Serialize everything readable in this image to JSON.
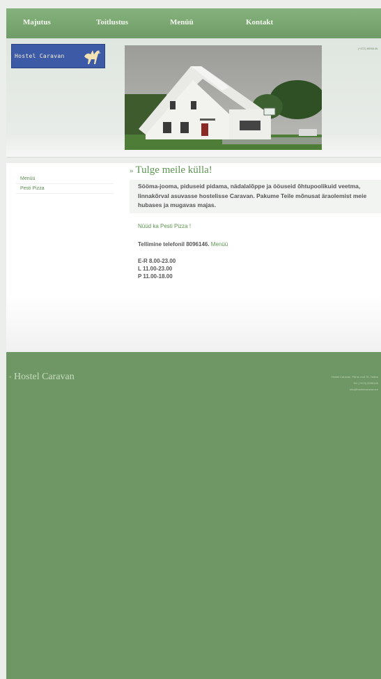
{
  "nav": {
    "items": [
      "Majutus",
      "Toitlustus",
      "Menüü",
      "Kontakt"
    ]
  },
  "header": {
    "logo_text": "Hostel Caravan",
    "phone_text": "(+372) 8096146"
  },
  "sidebar": {
    "items": [
      "Menüü",
      "Pesti Pizza"
    ]
  },
  "main": {
    "title": "Tulge meile külla!",
    "intro": "Sööma-jooma, piduseid pidama, nädalalõppe ja ööuseid õhtupoolikuid veetma, linnakõrval asuvasse hostelisse Caravan. Pakume Teile mõnusat äraolemist meie hubases ja mugavas majas.",
    "pizza_link": "Nüüd ka Pesti Pizza !",
    "order_text": "Tellimine telefonil 8096146.",
    "order_link": "Menüü",
    "hours": [
      "E-R 8.00-23.00",
      "L 11.00-23.00",
      "P 11.00-18.00"
    ]
  },
  "footer": {
    "title": "Hostel Caravan",
    "info": [
      "Hostel Caravan, Pärnu mnt 76, Tallinn",
      "Tel: (+372) 8096146",
      "info@hostelcaravan.ee"
    ]
  },
  "colors": {
    "accent": "#6f9c66",
    "footer": "#6f9765",
    "logo_bg": "#3c5aa6"
  },
  "icons": {
    "logo": "camel-icon",
    "title_marker": "double-chevron-icon"
  }
}
